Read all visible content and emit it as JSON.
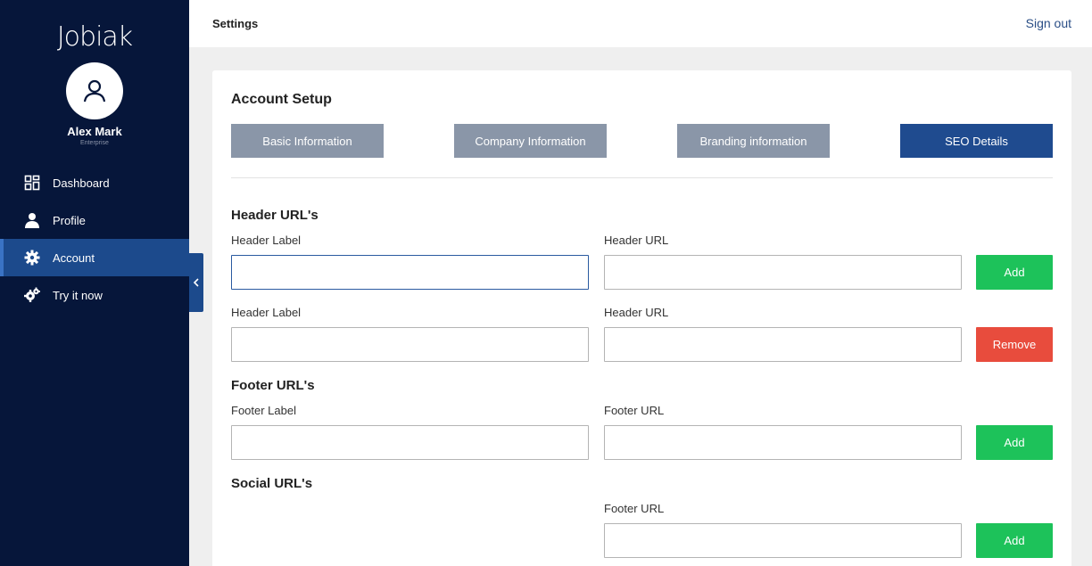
{
  "sidebar": {
    "logo": "Jobiak",
    "user": {
      "name": "Alex Mark",
      "role": "Enterprise"
    },
    "items": [
      {
        "label": "Dashboard",
        "icon": "dashboard-grid-icon"
      },
      {
        "label": "Profile",
        "icon": "person-icon"
      },
      {
        "label": "Account",
        "icon": "gear-icon",
        "active": true
      },
      {
        "label": "Try it now",
        "icon": "gears-icon"
      }
    ]
  },
  "header": {
    "title": "Settings",
    "sign_out": "Sign out"
  },
  "main": {
    "section_title": "Account Setup",
    "tabs": [
      {
        "label": "Basic Information",
        "active": false
      },
      {
        "label": "Company Information",
        "active": false
      },
      {
        "label": "Branding information",
        "active": false
      },
      {
        "label": "SEO Details",
        "active": true
      }
    ],
    "header_urls": {
      "title": "Header URL's",
      "rows": [
        {
          "label_caption": "Header Label",
          "url_caption": "Header URL",
          "label_value": "",
          "url_value": "",
          "button": "Add"
        },
        {
          "label_caption": "Header Label",
          "url_caption": "Header URL",
          "label_value": "",
          "url_value": "",
          "button": "Remove"
        }
      ]
    },
    "footer_urls": {
      "title": "Footer URL's",
      "rows": [
        {
          "label_caption": "Footer Label",
          "url_caption": "Footer URL",
          "label_value": "",
          "url_value": "",
          "button": "Add"
        }
      ]
    },
    "social_urls": {
      "title": "Social URL's",
      "rows": [
        {
          "url_caption": "Footer URL",
          "url_value": "",
          "button": "Add"
        }
      ]
    }
  },
  "colors": {
    "sidebar_bg": "#06163a",
    "accent": "#1f4b8f",
    "add": "#1dc25a",
    "remove": "#e84c3d",
    "tab_inactive": "#8a96a8"
  }
}
